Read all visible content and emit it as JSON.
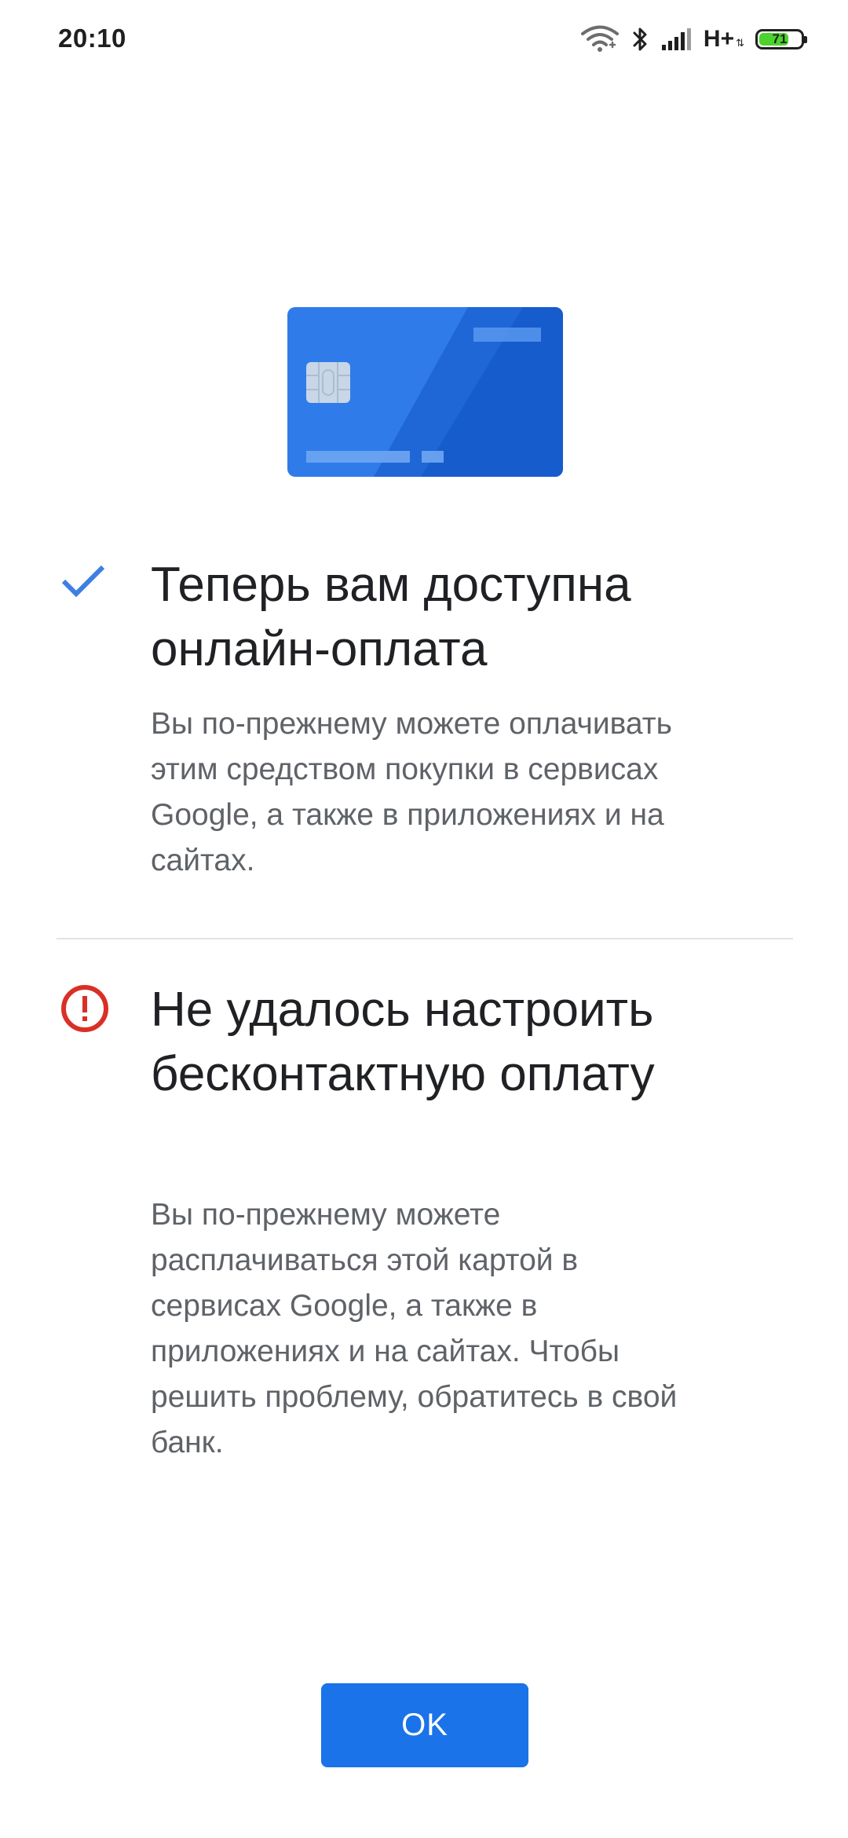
{
  "status_bar": {
    "time": "20:10",
    "network_type": "H+",
    "battery_percent": 71,
    "battery_label": "71",
    "icons": [
      "wifi-icon",
      "bluetooth-icon",
      "signal-icon",
      "battery-icon"
    ]
  },
  "illustration": {
    "icon": "credit-card-icon",
    "card_color": "#1a73e8"
  },
  "success_section": {
    "icon": "checkmark-icon",
    "icon_color": "#1a73e8",
    "title": "Теперь вам доступна онлайн-оплата",
    "body": "Вы по-прежнему можете оплачивать этим средством покупки в сервисах Google, а также в приложениях и на сайтах."
  },
  "error_section": {
    "icon": "error-icon",
    "icon_color": "#d93025",
    "title": "Не удалось настроить бесконтактную оплату",
    "body": "Вы по-прежнему можете расплачиваться этой картой в сервисах Google, а также в приложениях и на сайтах. Чтобы решить проблему, обратитесь в свой банк."
  },
  "ok_button": {
    "label": "OK",
    "color": "#1a73e8"
  }
}
